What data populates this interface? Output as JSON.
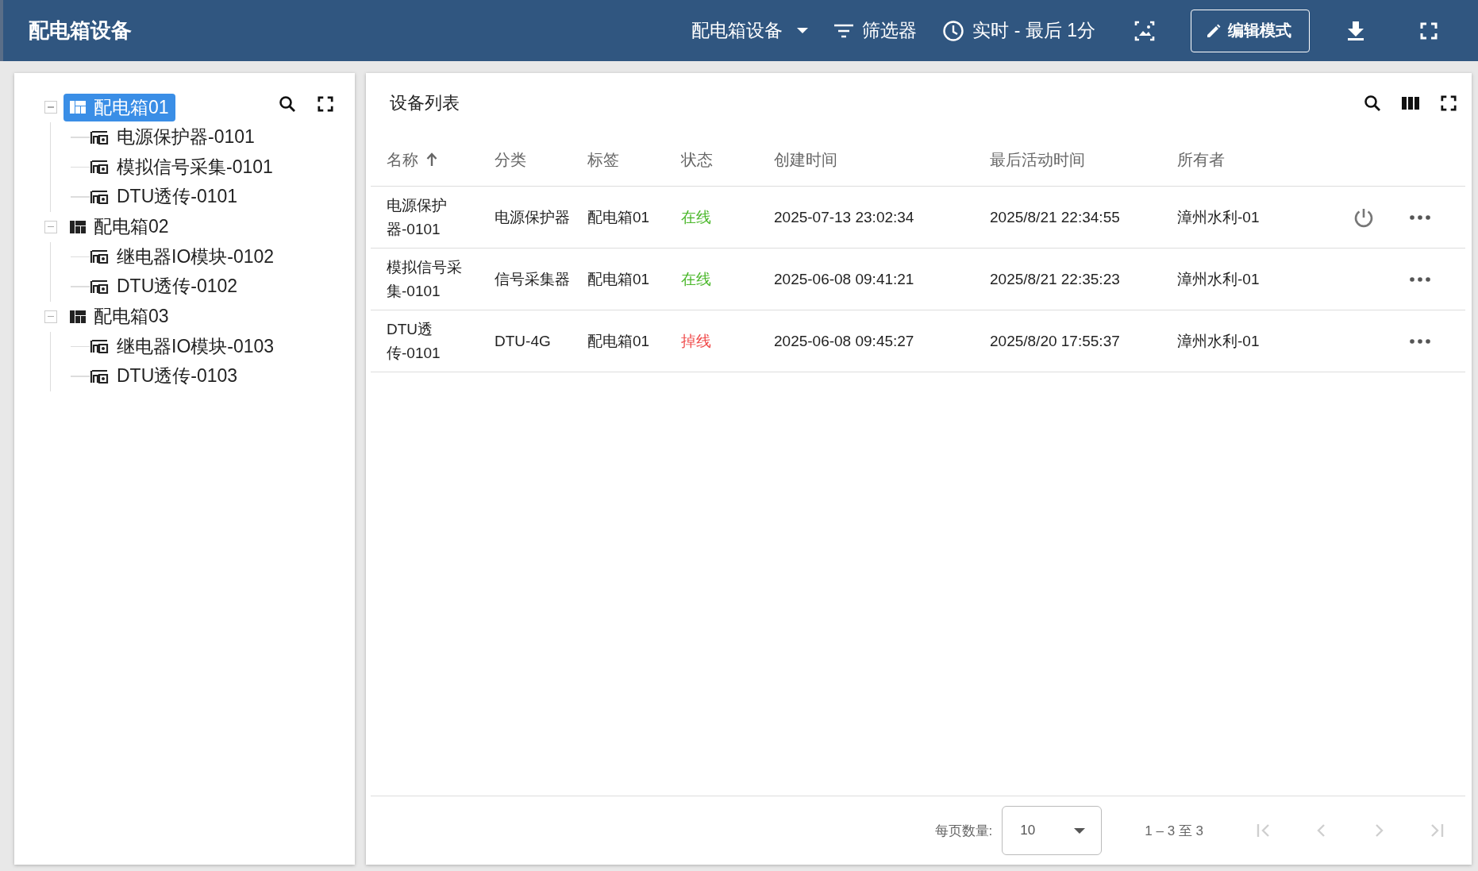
{
  "top_bar": {
    "title": "配电箱设备",
    "dashboard_select": "配电箱设备",
    "filter_label": "筛选器",
    "time_label": "实时 - 最后 1分",
    "edit_button": "编辑模式"
  },
  "tree": {
    "nodes": [
      {
        "label": "配电箱01",
        "kind": "box",
        "selected": true,
        "expanded": true,
        "children": [
          {
            "label": "电源保护器-0101",
            "kind": "device",
            "selected": false
          },
          {
            "label": "模拟信号采集-0101",
            "kind": "device",
            "selected": false
          },
          {
            "label": "DTU透传-0101",
            "kind": "device",
            "selected": false
          }
        ]
      },
      {
        "label": "配电箱02",
        "kind": "box",
        "selected": false,
        "expanded": true,
        "children": [
          {
            "label": "继电器IO模块-0102",
            "kind": "device",
            "selected": false
          },
          {
            "label": "DTU透传-0102",
            "kind": "device",
            "selected": false
          }
        ]
      },
      {
        "label": "配电箱03",
        "kind": "box",
        "selected": false,
        "expanded": true,
        "children": [
          {
            "label": "继电器IO模块-0103",
            "kind": "device",
            "selected": false
          },
          {
            "label": "DTU透传-0103",
            "kind": "device",
            "selected": false
          }
        ]
      }
    ]
  },
  "device_table": {
    "title": "设备列表",
    "columns": [
      {
        "label": "名称",
        "sorted": true
      },
      {
        "label": "分类",
        "sorted": false
      },
      {
        "label": "标签",
        "sorted": false
      },
      {
        "label": "状态",
        "sorted": false
      },
      {
        "label": "创建时间",
        "sorted": false
      },
      {
        "label": "最后活动时间",
        "sorted": false
      },
      {
        "label": "所有者",
        "sorted": false
      }
    ],
    "rows": [
      {
        "name": "电源保护器-0101",
        "category": "电源保护器",
        "tag": "配电箱01",
        "status": "在线",
        "online": true,
        "created": "2025-07-13 23:02:34",
        "last_active": "2025/8/21 22:34:55",
        "owner": "漳州水利-01",
        "power_button": true
      },
      {
        "name": "模拟信号采集-0101",
        "category": "信号采集器",
        "tag": "配电箱01",
        "status": "在线",
        "online": true,
        "created": "2025-06-08 09:41:21",
        "last_active": "2025/8/21 22:35:23",
        "owner": "漳州水利-01",
        "power_button": false
      },
      {
        "name": "DTU透传-0101",
        "category": "DTU-4G",
        "tag": "配电箱01",
        "status": "掉线",
        "online": false,
        "created": "2025-06-08 09:45:27",
        "last_active": "2025/8/20 17:55:37",
        "owner": "漳州水利-01",
        "power_button": false
      }
    ],
    "pagination": {
      "page_size_label": "每页数量:",
      "page_size": "10",
      "range": "1 – 3 至 3",
      "first_disabled": true,
      "prev_disabled": true,
      "next_disabled": true,
      "last_disabled": true
    }
  }
}
